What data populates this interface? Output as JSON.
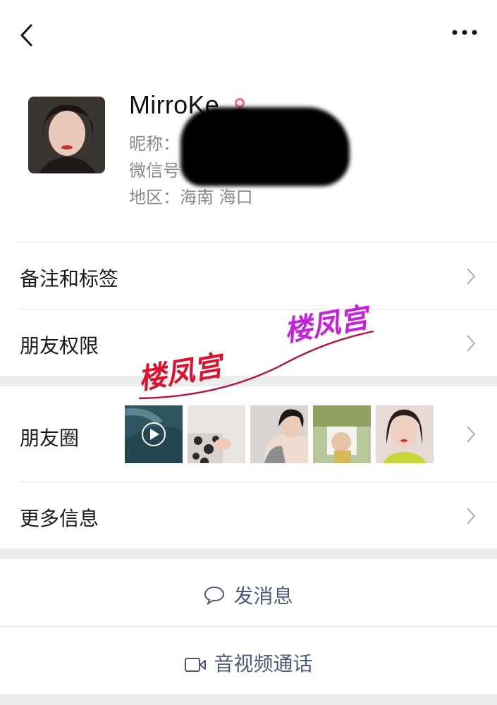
{
  "profile": {
    "name": "MirroKe",
    "nickname_label": "昵称：",
    "wechat_id_label": "微信号",
    "region": "地区：海南 海口"
  },
  "rows": {
    "remarks": "备注和标签",
    "permissions": "朋友权限",
    "moments": "朋友圈",
    "more_info": "更多信息"
  },
  "actions": {
    "send_message": "发消息",
    "video_call": "音视频通话"
  },
  "watermark": {
    "text_left": "楼凤宫",
    "text_right": "楼凤宫"
  },
  "colors": {
    "action_text": "#4a5a7f",
    "gender_icon": "#f2728a",
    "watermark_left": "#e0102c",
    "watermark_right": "#c71ee0"
  }
}
